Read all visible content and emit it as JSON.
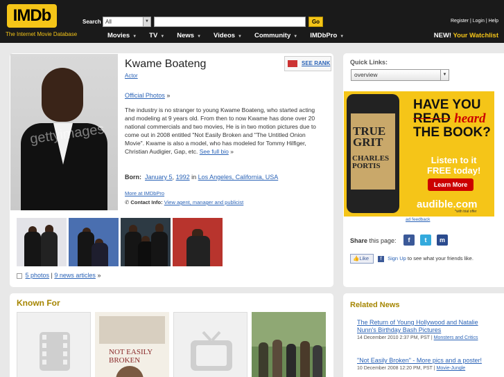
{
  "header": {
    "logo": "IMDb",
    "tagline": "The Internet Movie Database",
    "search_label": "Search",
    "search_scope": "All",
    "go_label": "Go",
    "user_links": [
      "Register",
      "Login",
      "Help"
    ],
    "nav": [
      "Movies",
      "TV",
      "News",
      "Videos",
      "Community",
      "IMDbPro"
    ],
    "watchlist_new": "NEW!",
    "watchlist_label": "Your Watchlist"
  },
  "profile": {
    "name": "Kwame Boateng",
    "role": "Actor",
    "see_rank": "SEE RANK",
    "official_photos": "Official Photos",
    "bio": "The industry is no stranger to young Kwame Boateng, who started acting and modeling at 9 years old. From then to now Kwame has done over 20 national commercials and two movies, He is in two motion pictures due to come out in 2008 entitled \"Not Easily Broken and \"The Untitled Onion Movie\". Kwame is also a model, who has modeled for Tommy Hilfiger, Christian Audigier, Gap, etc.",
    "see_full_bio": "See full bio",
    "born_label": "Born:",
    "born_date": "January 5",
    "born_year": "1992",
    "born_in": "in",
    "born_place": "Los Angeles, California, USA",
    "more_imdbpro": "More at IMDbPro",
    "contact_label": "Contact Info:",
    "contact_link": "View agent, manager and publicist",
    "photos_link": "5 photos",
    "news_link": "9 news articles",
    "headshot_watermark": "gettyimages"
  },
  "known_for": {
    "title": "Known For",
    "poster_title": "NOT EASILY BROKEN"
  },
  "sidebar": {
    "quick_links_label": "Quick Links:",
    "quick_links_value": "overview",
    "ad": {
      "have_you": "HAVE YOU",
      "read": "READ",
      "heard": "heard",
      "the_book": "THE BOOK?",
      "listen": "Listen to it",
      "free_today": "FREE today!",
      "learn_more": "Learn More",
      "brand": "audible.com",
      "fine_print": "*with trial offer",
      "book_title": "TRUE GRIT",
      "book_author": "CHARLES PORTIS"
    },
    "ad_feedback": "ad feedback",
    "share_label_bold": "Share",
    "share_label_rest": "this page:",
    "like_label": "Like",
    "signup_link": "Sign Up",
    "signup_rest": "to see what your friends like."
  },
  "related_news": {
    "title": "Related News",
    "items": [
      {
        "headline": "The Return of Young Hollywood and Natalie Nunn's Birthday Bash Pictures",
        "meta": "14 December 2010 2:37 PM, PST |",
        "source": "Monsters and Critics"
      },
      {
        "headline": "\"Not Easily Broken\" - More pics and a poster!",
        "meta": "10 December 2008 12:20 PM, PST |",
        "source": "Movie-Jungle"
      }
    ]
  },
  "colors": {
    "accent": "#f5c518",
    "header_bg": "#1a1a1a",
    "link": "#2962b6",
    "section_title": "#a58500"
  }
}
